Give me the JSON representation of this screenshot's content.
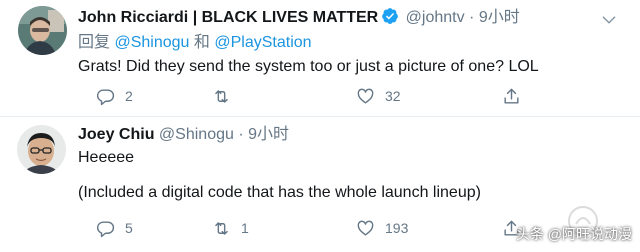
{
  "tweets": [
    {
      "display_name": "John Ricciardi | BLACK LIVES MATTER",
      "verified": true,
      "handle": "@johntv",
      "separator": "·",
      "time": "9小时",
      "reply_prefix": "回复",
      "reply_mention_1": "@Shinogu",
      "reply_and": "和",
      "reply_mention_2": "@PlayStation",
      "text": "Grats! Did they send the system too or just a picture of one? LOL",
      "reply_count": "2",
      "retweet_count": "",
      "like_count": "32"
    },
    {
      "display_name": "Joey Chiu",
      "handle": "@Shinogu",
      "separator": "·",
      "time": "9小时",
      "text_line_1": "Heeeee",
      "text_line_2": "(Included a digital code that has the whole launch lineup)",
      "reply_count": "5",
      "retweet_count": "1",
      "like_count": "193"
    }
  ],
  "watermark": {
    "text": "头条 @阿旺说动漫"
  },
  "colors": {
    "text": "#14171a",
    "secondary": "#657786",
    "link": "#1b95e0",
    "verified": "#1da1f2",
    "divider": "#e6ecf0"
  },
  "icons": [
    "more-icon",
    "verified-badge-icon",
    "reply-icon",
    "retweet-icon",
    "like-icon",
    "share-icon"
  ]
}
